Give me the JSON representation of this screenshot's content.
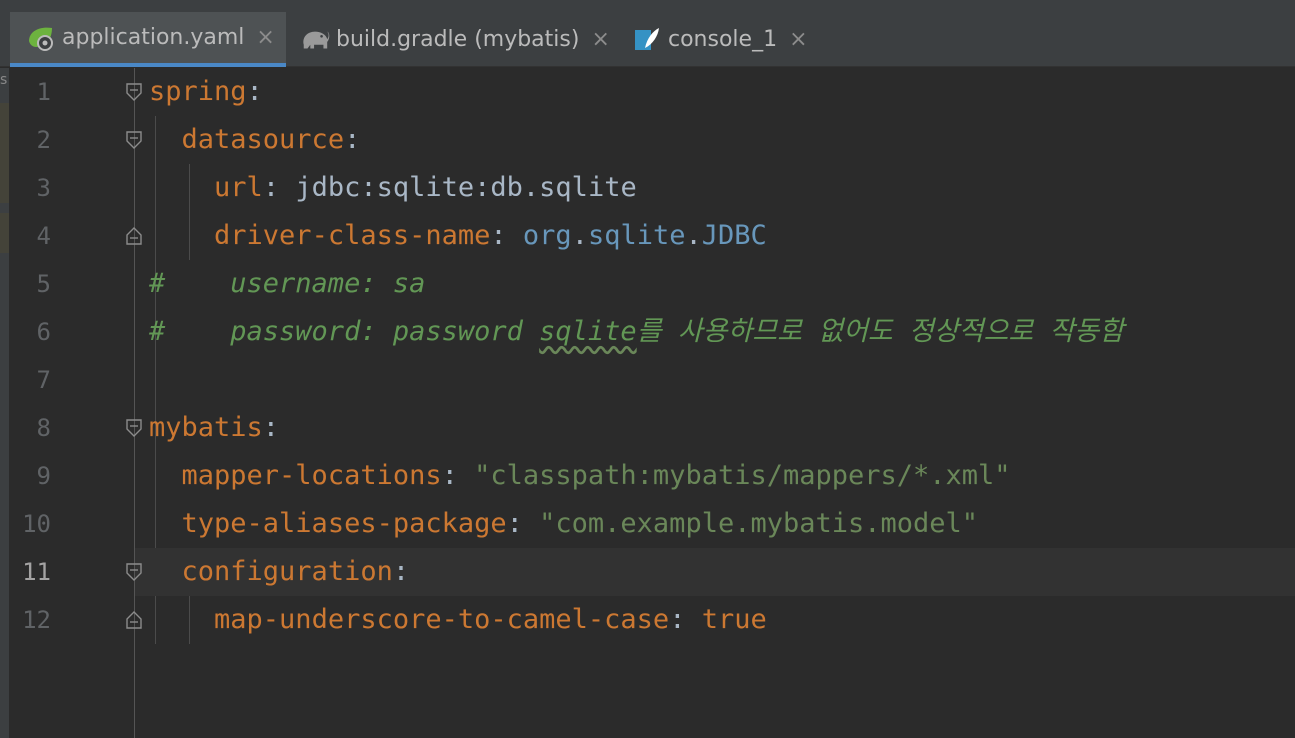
{
  "tabs": [
    {
      "label": "application.yaml",
      "icon": "spring-leaf-icon",
      "active": true
    },
    {
      "label": "build.gradle (mybatis)",
      "icon": "gradle-elephant-icon",
      "active": false
    },
    {
      "label": "console_1",
      "icon": "sql-console-icon",
      "active": false
    }
  ],
  "tab_close_glyph": "×",
  "left_strip_char": "s",
  "lines": [
    {
      "n": "1",
      "key": "spring",
      "colon": ":"
    },
    {
      "n": "2",
      "key": "datasource",
      "colon": ":"
    },
    {
      "n": "3",
      "key": "url",
      "colon": ":",
      "value": "jdbc:sqlite:db.sqlite"
    },
    {
      "n": "4",
      "key": "driver-class-name",
      "colon": ":",
      "value_a": "org",
      "value_dot1": ".",
      "value_b": "sqlite",
      "value_dot2": ".",
      "value_c": "JDBC"
    },
    {
      "n": "5",
      "comment": "#    username: sa"
    },
    {
      "n": "6",
      "comment_a": "#    password: password ",
      "comment_typo": "sqlite",
      "comment_b": "를 사용하므로 없어도 정상적으로 작동함"
    },
    {
      "n": "7"
    },
    {
      "n": "8",
      "key": "mybatis",
      "colon": ":"
    },
    {
      "n": "9",
      "key": "mapper-locations",
      "colon": ": ",
      "value": "\"classpath:mybatis/mappers/*.xml\""
    },
    {
      "n": "10",
      "key": "type-aliases-package",
      "colon": ": ",
      "value": "\"com.example.mybatis.model\""
    },
    {
      "n": "11",
      "key": "configuration",
      "colon": ":"
    },
    {
      "n": "12",
      "key": "map-underscore-to-camel-case",
      "colon": ": ",
      "value": "true"
    }
  ],
  "current_line": "11",
  "colors": {
    "background": "#2b2b2b",
    "key": "#cc7832",
    "string": "#6a8759",
    "comment": "#629755",
    "class": "#6897bb",
    "tab_underline": "#4a88c7"
  }
}
